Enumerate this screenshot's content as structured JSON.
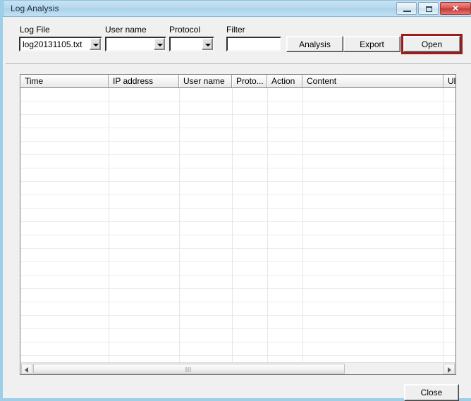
{
  "window": {
    "title": "Log Analysis",
    "caption_buttons": {
      "minimize": "minimize",
      "maximize": "maximize",
      "close": "✕"
    }
  },
  "toolbar": {
    "fields": [
      {
        "label": "Log File",
        "value": "log20131105.txt",
        "type": "combobox"
      },
      {
        "label": "User name",
        "value": "",
        "type": "combobox"
      },
      {
        "label": "Protocol",
        "value": "",
        "type": "combobox"
      },
      {
        "label": "Filter",
        "value": "",
        "type": "textbox"
      }
    ],
    "buttons": [
      {
        "label": "Analysis",
        "highlighted": false
      },
      {
        "label": "Export",
        "highlighted": false
      },
      {
        "label": "Open",
        "highlighted": true
      }
    ],
    "highlight_color": "#9e1b1b"
  },
  "grid": {
    "columns": [
      {
        "label": "Time"
      },
      {
        "label": "IP address"
      },
      {
        "label": "User name"
      },
      {
        "label": "Proto..."
      },
      {
        "label": "Action"
      },
      {
        "label": "Content"
      },
      {
        "label": "Ul"
      }
    ],
    "rows": [],
    "row_count": 0,
    "scrollbar": {
      "left_arrow": "◄",
      "right_arrow": "►",
      "thumb_position": "left",
      "thumb_fraction": 0.74
    }
  },
  "footer": {
    "close_button": "Close"
  }
}
